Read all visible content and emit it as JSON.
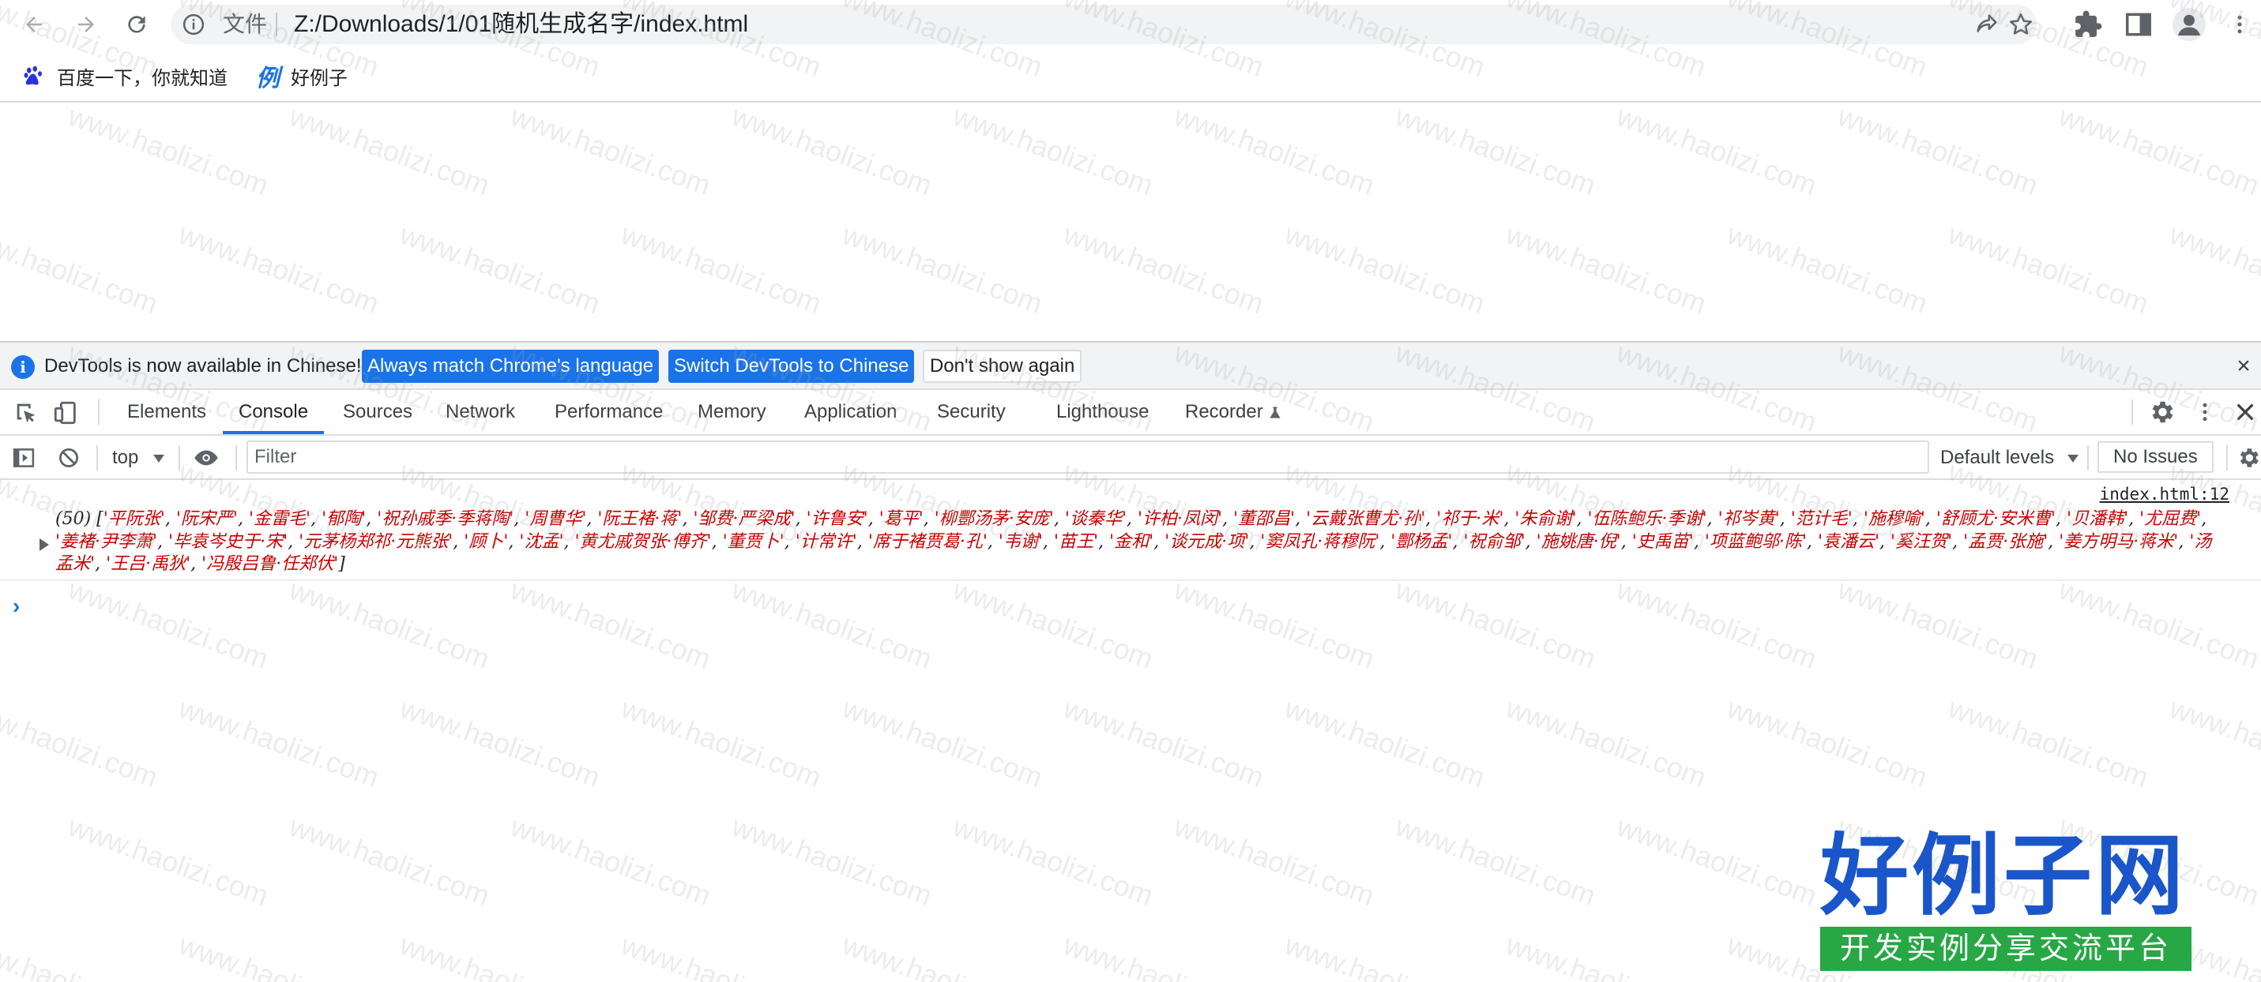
{
  "toolbar": {
    "omnibox_label": "文件",
    "url": "Z:/Downloads/1/01随机生成名字/index.html"
  },
  "bookmarks": [
    {
      "label": "百度一下，你就知道",
      "icon": "baidu-paw-icon"
    },
    {
      "label": "好例子",
      "icon_text": "例",
      "icon": "haolizi-icon"
    }
  ],
  "devtools": {
    "infobar": {
      "message": "DevTools is now available in Chinese!",
      "btn_match": "Always match Chrome's language",
      "btn_switch": "Switch DevTools to Chinese",
      "btn_dont_show": "Don't show again"
    },
    "tabs": [
      "Elements",
      "Console",
      "Sources",
      "Network",
      "Performance",
      "Memory",
      "Application",
      "Security",
      "Lighthouse",
      "Recorder"
    ],
    "active_tab": "Console",
    "console_toolbar": {
      "context": "top",
      "filter_placeholder": "Filter",
      "levels": "Default levels",
      "issues": "No Issues"
    },
    "log": {
      "source": "index.html:12",
      "count": "(50)",
      "items": [
        "平阮张",
        "阮宋严",
        "金雷毛",
        "郁陶",
        "祝孙戚季·季蒋陶",
        "周曹华",
        "阮王褚·蒋",
        "邹费·严梁成",
        "许鲁安",
        "葛平",
        "柳酆汤茅·安庞",
        "谈秦华",
        "许柏·凤闵",
        "董邵昌",
        "云戴张曹尤·孙",
        "祁于·米",
        "朱俞谢",
        "伍陈鲍乐·季谢",
        "祁岑黄",
        "范计毛",
        "施穆喻",
        "舒顾尤·安米曹",
        "贝潘韩",
        "尤屈费",
        "姜褚·尹李萧",
        "毕袁岑史于·宋",
        "元茅杨郑祁·元熊张",
        "顾卜",
        "沈孟",
        "黄尤戚贺张·傅齐",
        "董贾卜",
        "计常许",
        "席于褚贾葛·孔",
        "韦谢",
        "苗王",
        "金和",
        "谈元成·项",
        "窦凤孔·蒋穆阮",
        "酆杨孟",
        "祝俞邹",
        "施姚唐·倪",
        "史禹苗",
        "项蓝鲍邬·陈",
        "袁潘云",
        "奚汪贺",
        "孟贾·张施",
        "姜方明马·蒋米",
        "汤孟米",
        "王吕·禹狄",
        "冯殷吕鲁·任郑伏"
      ]
    }
  },
  "watermark": {
    "text": "www.haolizi.com",
    "logo_main": "好例子网",
    "logo_sub": "开发实例分享交流平台"
  },
  "colors": {
    "accent": "#1a73e8",
    "string_red": "#c80000",
    "logo_blue": "#1a56c9",
    "logo_green": "#28a745"
  }
}
